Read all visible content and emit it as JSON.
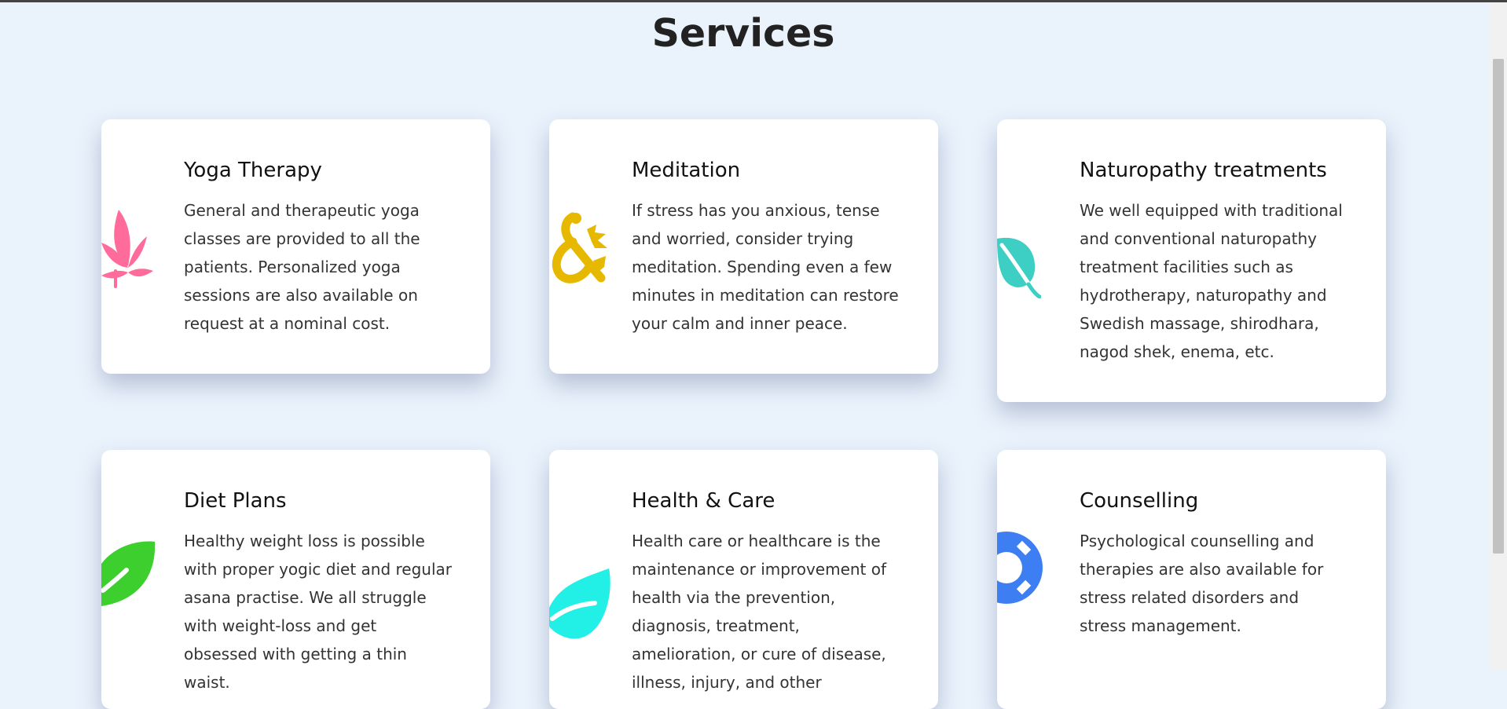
{
  "page": {
    "title": "Services"
  },
  "services": [
    {
      "title": "Yoga Therapy",
      "description": "General and therapeutic yoga classes are provided to all the patients. Personalized yoga sessions are also available on request at a nominal cost.",
      "icon": "cannabis-leaf-icon",
      "color": "#ff6b9a"
    },
    {
      "title": "Meditation",
      "description": "If stress has you anxious, tense and worried, consider trying meditation. Spending even a few minutes in meditation can restore your calm and inner peace.",
      "icon": "dragon-ampersand-icon",
      "color": "#e6b800"
    },
    {
      "title": "Naturopathy treatments",
      "description": "We well equipped with traditional and conventional naturopathy treatment facilities such as hydrotherapy, naturopathy and Swedish massage, shirodhara, nagod shek, enema, etc.",
      "icon": "leaf-icon",
      "color": "#3ecfc4"
    },
    {
      "title": "Diet Plans",
      "description": "Healthy weight loss is possible with proper yogic diet and regular asana practise. We all struggle with weight-loss and get obsessed with getting a thin waist.",
      "icon": "feather-leaf-icon",
      "color": "#3ccf2e"
    },
    {
      "title": "Health & Care",
      "description": "Health care or healthcare is the maintenance or improvement of health via the prevention, diagnosis, treatment, amelioration, or cure of disease, illness, injury, and other",
      "icon": "leaf-icon",
      "color": "#22f0e6"
    },
    {
      "title": "Counselling",
      "description": "Psychological counselling and therapies are also available for stress related disorders and stress management.",
      "icon": "life-ring-icon",
      "color": "#3d7ff2"
    }
  ]
}
